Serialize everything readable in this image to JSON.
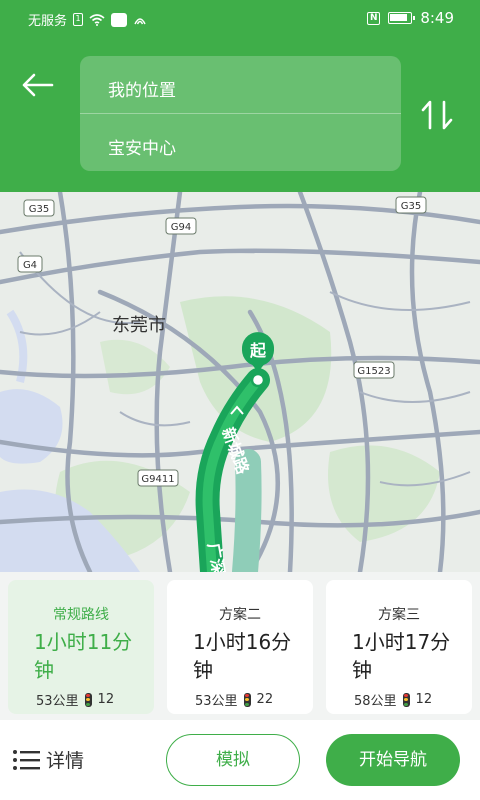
{
  "status_bar": {
    "carrier": "无服务",
    "sim_label": "1",
    "time": "8:49",
    "nfc_label": "N"
  },
  "header": {
    "from": "我的位置",
    "to": "宝安中心"
  },
  "map": {
    "city_label": "东莞市",
    "start_label": "起",
    "road_labels": [
      {
        "code": "G35"
      },
      {
        "code": "G94"
      },
      {
        "code": "G35"
      },
      {
        "code": "G4"
      },
      {
        "code": "G1523"
      },
      {
        "code": "G9411"
      }
    ],
    "route_text_1": "新城路",
    "route_text_2": "广深",
    "colors": {
      "route": "#1aa55a",
      "alt_route": "#8fcdb8",
      "road": "#9aa5b5",
      "water": "#d4dcef",
      "green": "#cfe6cc"
    }
  },
  "plans": [
    {
      "name": "常规路线",
      "time": "1小时11分钟",
      "distance": "53公里",
      "lights": "12",
      "selected": true
    },
    {
      "name": "方案二",
      "time": "1小时16分钟",
      "distance": "53公里",
      "lights": "22",
      "selected": false
    },
    {
      "name": "方案三",
      "time": "1小时17分钟",
      "distance": "58公里",
      "lights": "12",
      "selected": false
    }
  ],
  "bottom": {
    "details": "详情",
    "simulate": "模拟",
    "start": "开始导航"
  }
}
